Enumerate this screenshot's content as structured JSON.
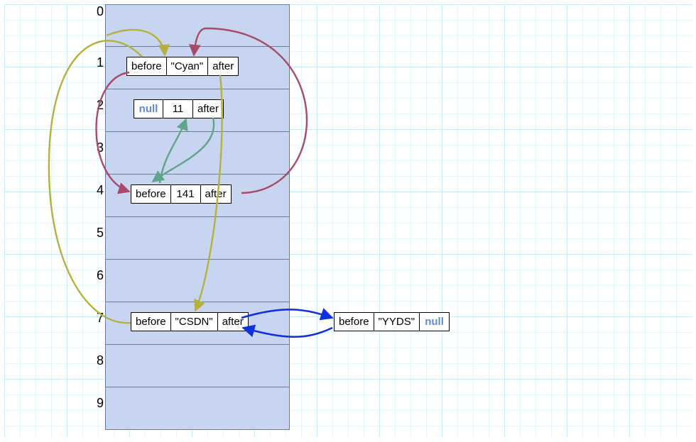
{
  "indices": [
    "0",
    "1",
    "2",
    "3",
    "4",
    "5",
    "6",
    "7",
    "8",
    "9"
  ],
  "labels": {
    "before": "before",
    "after": "after",
    "null": "null"
  },
  "nodes": {
    "n1": {
      "before": "before",
      "value": "\"Cyan\"",
      "after": "after"
    },
    "n2": {
      "before": "null",
      "value": "11",
      "after": "after"
    },
    "n4": {
      "before": "before",
      "value": "141",
      "after": "after"
    },
    "n7": {
      "before": "before",
      "value": "\"CSDN\"",
      "after": "after"
    },
    "n7b": {
      "before": "before",
      "value": "\"YYDS\"",
      "after": "null"
    }
  },
  "colors": {
    "maroon": "#a84a6a",
    "green": "#5fa58b",
    "olive": "#b6b13f",
    "blue": "#1030e0"
  }
}
